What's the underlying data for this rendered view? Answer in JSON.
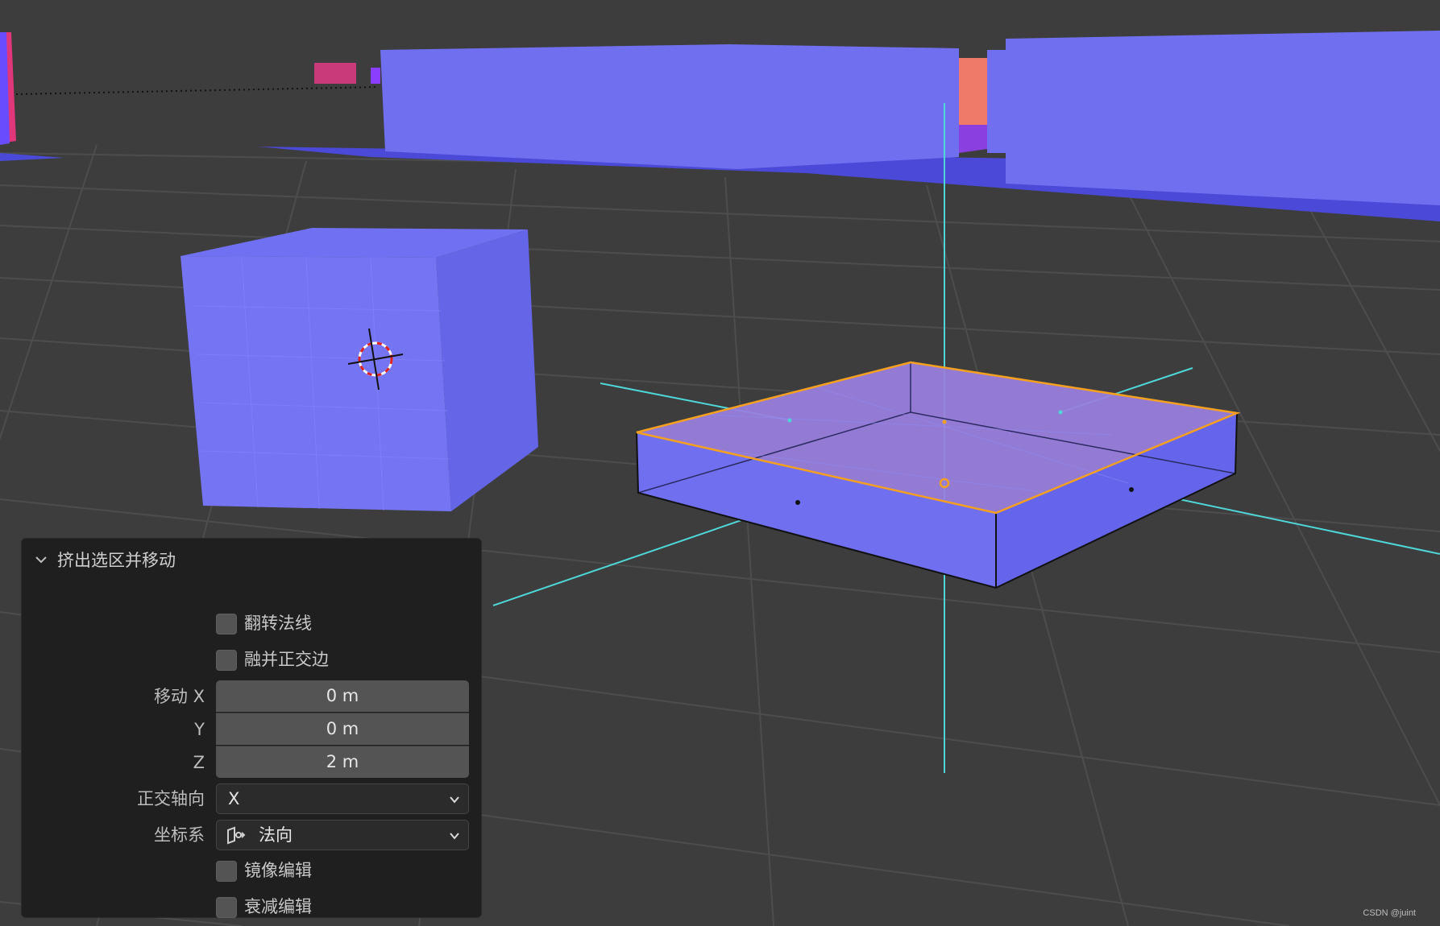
{
  "panel": {
    "title": "挤出选区并移动",
    "flip_normals_label": "翻转法线",
    "dissolve_orthogonal_label": "融并正交边",
    "move_x_label": "移动 X",
    "move_y_label": "Y",
    "move_z_label": "Z",
    "move_x_value": "0 m",
    "move_y_value": "0 m",
    "move_z_value": "2 m",
    "orient_axis_label": "正交轴向",
    "orient_axis_value": "X",
    "orientation_label": "坐标系",
    "orientation_value": "法向",
    "orientation_icon": "normal-orientation-icon",
    "mirror_label": "镜像编辑",
    "proportional_label": "衰减编辑"
  },
  "watermark": "CSDN @juint",
  "colors": {
    "viewport_bg": "#3d3d3d",
    "mesh_face": "#6f6ff0",
    "selected_face": "#9a7fe0",
    "selection_edge": "#f5a020",
    "transform_axis": "#4fd6d6",
    "panel_bg": "#1f1f1f",
    "field_bg": "#545454"
  }
}
